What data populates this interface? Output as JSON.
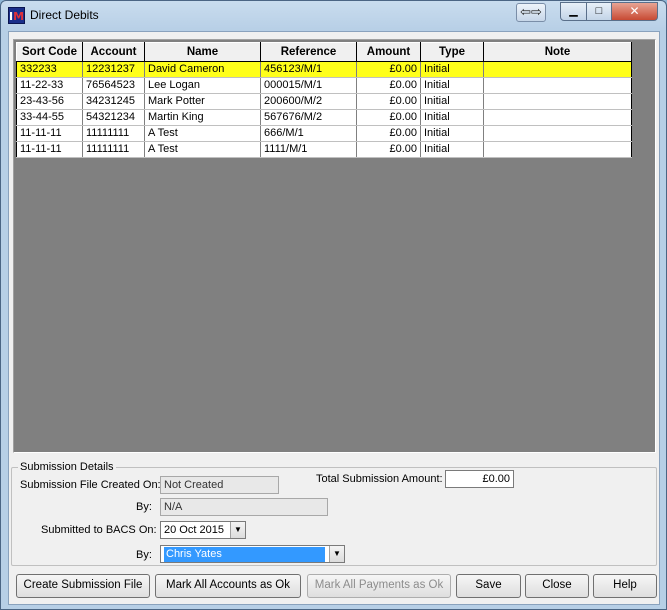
{
  "window": {
    "title": "Direct Debits",
    "app_icon": "IM",
    "colors": {
      "selected_row": "#ffff1a",
      "grid_background": "#808080",
      "combo_selected": "#3399ff"
    }
  },
  "grid": {
    "columns": [
      "Sort Code",
      "Account",
      "Name",
      "Reference",
      "Amount",
      "Type",
      "Note"
    ],
    "rows": [
      {
        "sort_code": "332233",
        "account": "12231237",
        "name": "David Cameron",
        "reference": "456123/M/1",
        "amount": "£0.00",
        "type": "Initial",
        "note": ""
      },
      {
        "sort_code": "11-22-33",
        "account": "76564523",
        "name": "Lee Logan",
        "reference": "000015/M/1",
        "amount": "£0.00",
        "type": "Initial",
        "note": ""
      },
      {
        "sort_code": "23-43-56",
        "account": "34231245",
        "name": "Mark Potter",
        "reference": "200600/M/2",
        "amount": "£0.00",
        "type": "Initial",
        "note": ""
      },
      {
        "sort_code": "33-44-55",
        "account": "54321234",
        "name": "Martin King",
        "reference": "567676/M/2",
        "amount": "£0.00",
        "type": "Initial",
        "note": ""
      },
      {
        "sort_code": "11-11-11",
        "account": "11111111",
        "name": "A Test",
        "reference": "666/M/1",
        "amount": "£0.00",
        "type": "Initial",
        "note": ""
      },
      {
        "sort_code": "11-11-11",
        "account": "11111111",
        "name": "A Test",
        "reference": "1111/M/1",
        "amount": "£0.00",
        "type": "Initial",
        "note": ""
      }
    ]
  },
  "submission": {
    "legend": "Submission Details",
    "file_created_label": "Submission File Created On:",
    "file_created_value": "Not Created",
    "by_label": "By:",
    "by_value": "N/A",
    "total_label": "Total Submission Amount:",
    "total_value": "£0.00",
    "submitted_label": "Submitted to BACS On:",
    "submitted_value": "20 Oct  2015",
    "submitted_by_label": "By:",
    "submitted_by_value": "Chris Yates"
  },
  "buttons": {
    "create": "Create Submission File",
    "mark_accounts": "Mark All Accounts as Ok",
    "mark_payments": "Mark All Payments as Ok",
    "save": "Save",
    "close": "Close",
    "help": "Help"
  }
}
